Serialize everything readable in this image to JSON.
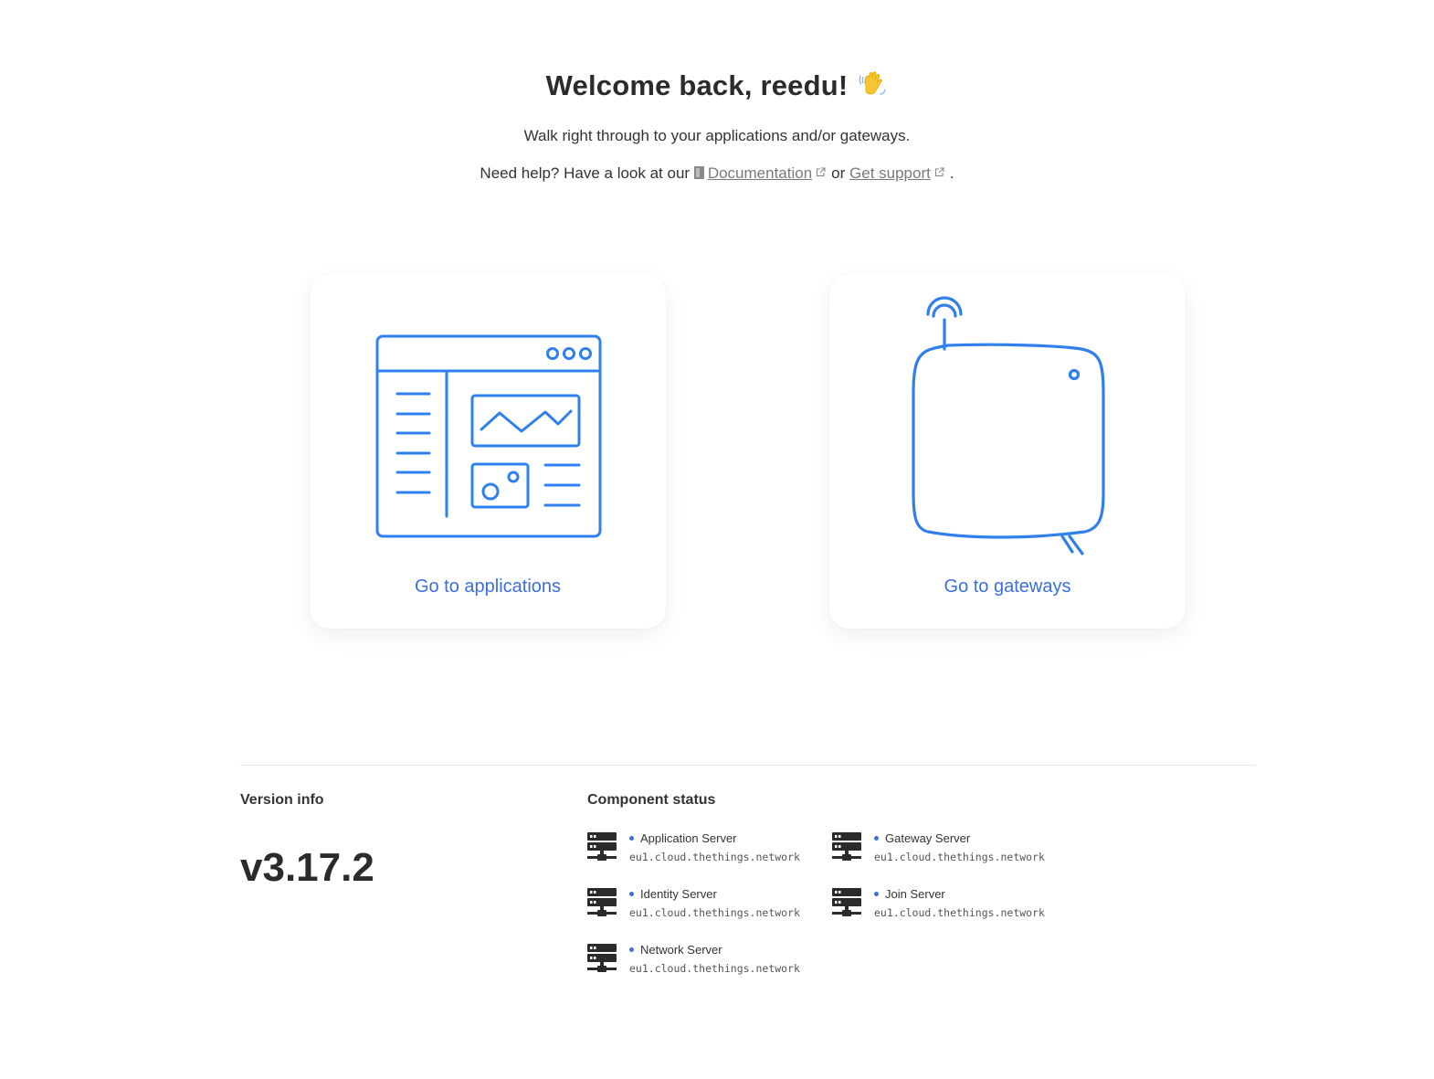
{
  "welcome": {
    "title": "Welcome back, reedu!",
    "emoji_icon": "waving-hand-icon",
    "subtitle": "Walk right through to your applications and/or gateways.",
    "help_prefix": "Need help? Have a look at our",
    "doc_link": "Documentation",
    "or_text": "or",
    "support_link": "Get support",
    "period": "."
  },
  "cards": {
    "applications": {
      "label": "Go to applications",
      "illustration": "application-window-illustration"
    },
    "gateways": {
      "label": "Go to gateways",
      "illustration": "gateway-device-illustration"
    }
  },
  "colors": {
    "accent": "#3b6fe0",
    "illustration_stroke": "#2f80ed"
  },
  "version": {
    "heading": "Version info",
    "value": "v3.17.2"
  },
  "status": {
    "heading": "Component status",
    "components": [
      {
        "name": "Application Server",
        "host": "eu1.cloud.thethings.network"
      },
      {
        "name": "Gateway Server",
        "host": "eu1.cloud.thethings.network"
      },
      {
        "name": "Identity Server",
        "host": "eu1.cloud.thethings.network"
      },
      {
        "name": "Join Server",
        "host": "eu1.cloud.thethings.network"
      },
      {
        "name": "Network Server",
        "host": "eu1.cloud.thethings.network"
      }
    ]
  }
}
